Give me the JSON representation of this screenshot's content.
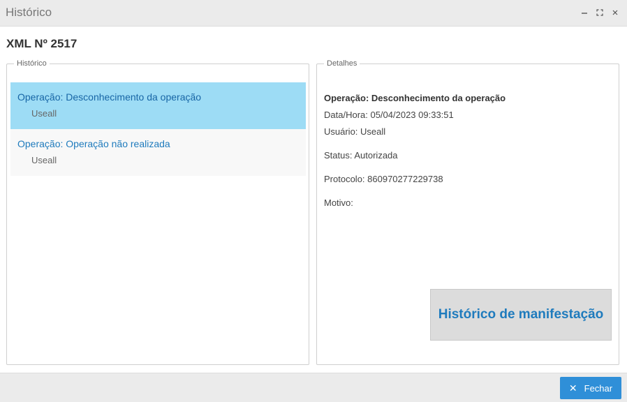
{
  "window": {
    "title": "Histórico",
    "minimize_icon": "minimize-icon",
    "maximize_icon": "maximize-icon",
    "close_icon": "close-icon"
  },
  "heading": "XML Nº 2517",
  "historico": {
    "legend": "Histórico",
    "items": [
      {
        "operation": "Operação: Desconhecimento da operação",
        "user": "Useall",
        "selected": true
      },
      {
        "operation": "Operação: Operação não realizada",
        "user": "Useall",
        "selected": false
      }
    ]
  },
  "detalhes": {
    "legend": "Detalhes",
    "operation": "Operação: Desconhecimento da operação",
    "datetime": "Data/Hora: 05/04/2023 09:33:51",
    "user": "Usuário: Useall",
    "status": "Status: Autorizada",
    "protocol": "Protocolo: 860970277229738",
    "reason": "Motivo:",
    "manifest_button": "Histórico de manifestação"
  },
  "footer": {
    "close_label": "Fechar"
  },
  "colors": {
    "accent": "#2f8fd8",
    "selected_bg": "#9ddcf5",
    "link_text": "#1f7bbd"
  }
}
